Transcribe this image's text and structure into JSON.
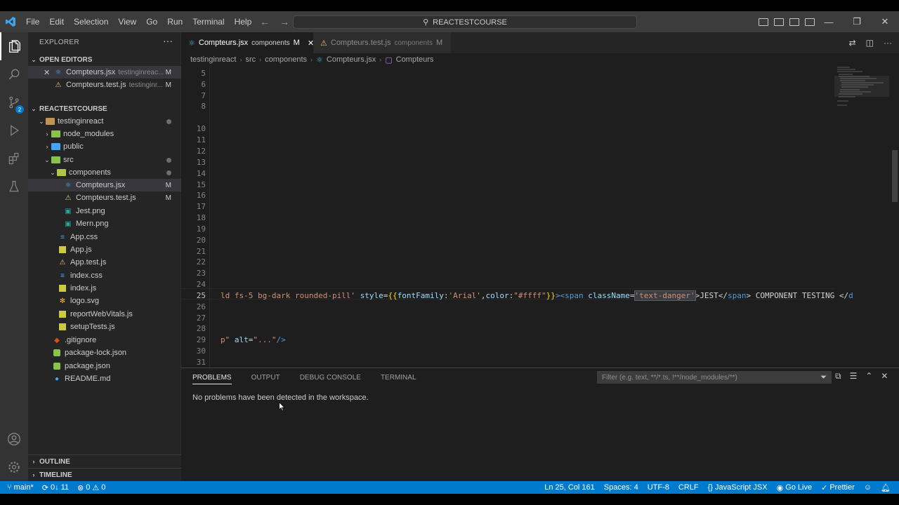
{
  "menu": [
    "File",
    "Edit",
    "Selection",
    "View",
    "Go",
    "Run",
    "Terminal",
    "Help"
  ],
  "command_center": "REACTESTCOURSE",
  "colors": {
    "accent": "#007acc",
    "react": "#41b3d6",
    "warning": "#e5c07b"
  },
  "activity_badge": "2",
  "explorer": {
    "title": "EXPLORER",
    "open_editors_label": "OPEN EDITORS",
    "open_editors": [
      {
        "name": "Compteurs.jsx",
        "desc": "testinginreac...",
        "status": "M"
      },
      {
        "name": "Compteurs.test.js",
        "desc": "testinginr...",
        "status": "M"
      }
    ],
    "workspace_label": "REACTESTCOURSE",
    "tree": [
      {
        "name": "testinginreact"
      },
      {
        "name": "node_modules"
      },
      {
        "name": "public"
      },
      {
        "name": "src"
      },
      {
        "name": "components"
      },
      {
        "name": "Compteurs.jsx",
        "status": "M"
      },
      {
        "name": "Compteurs.test.js",
        "status": "M"
      },
      {
        "name": "Jest.png"
      },
      {
        "name": "Mern.png"
      },
      {
        "name": "App.css"
      },
      {
        "name": "App.js"
      },
      {
        "name": "App.test.js"
      },
      {
        "name": "index.css"
      },
      {
        "name": "index.js"
      },
      {
        "name": "logo.svg"
      },
      {
        "name": "reportWebVitals.js"
      },
      {
        "name": "setupTests.js"
      },
      {
        "name": ".gitignore"
      },
      {
        "name": "package-lock.json"
      },
      {
        "name": "package.json"
      },
      {
        "name": "README.md"
      }
    ],
    "outline_label": "OUTLINE",
    "timeline_label": "TIMELINE"
  },
  "tabs": [
    {
      "name": "Compteurs.jsx",
      "desc": "components",
      "status": "M"
    },
    {
      "name": "Compteurs.test.js",
      "desc": "components",
      "status": "M"
    }
  ],
  "breadcrumb": [
    "testinginreact",
    "src",
    "components",
    "Compteurs.jsx",
    "Compteurs"
  ],
  "editor": {
    "line_numbers": [
      "5",
      "6",
      "7",
      "8",
      "10",
      "11",
      "12",
      "13",
      "14",
      "15",
      "16",
      "17",
      "18",
      "19",
      "20",
      "21",
      "22",
      "23",
      "24",
      "25",
      "26",
      "27",
      "28",
      "29",
      "30",
      "31"
    ],
    "current_line": "25",
    "line25": {
      "p1": "ld fs-5 bg-dark rounded-pill' ",
      "p2": "style",
      "p3": "=",
      "p4": "{{",
      "p5": "fontFamily",
      "p6": ":",
      "p7": "'Arial'",
      "p8": ",",
      "p9": "color",
      "p10": ":",
      "p11": "\"#ffff\"",
      "p12": "}}",
      "p13": "><",
      "p14": "span",
      "p15": " className",
      "p16": "=",
      "p17": "'text-danger'",
      "p18": ">JEST</",
      "p19": "span",
      "p20": "> COMPONENT TESTING </",
      "p21": "d"
    },
    "line29": {
      "p1": "p\" ",
      "p2": "alt",
      "p3": "=",
      "p4": "\"...\"",
      "p5": "/>"
    }
  },
  "panel": {
    "tabs": [
      "PROBLEMS",
      "OUTPUT",
      "DEBUG CONSOLE",
      "TERMINAL"
    ],
    "filter_placeholder": "Filter (e.g. text, **/*.ts, !**/node_modules/**)",
    "message": "No problems have been detected in the workspace."
  },
  "statusbar": {
    "branch": "main*",
    "sync": "0↓ 11",
    "errors": "0",
    "warnings": "0",
    "position": "Ln 25, Col 161",
    "spaces": "Spaces: 4",
    "encoding": "UTF-8",
    "eol": "CRLF",
    "language": "JavaScript JSX",
    "golive": "Go Live",
    "prettier": "Prettier"
  }
}
